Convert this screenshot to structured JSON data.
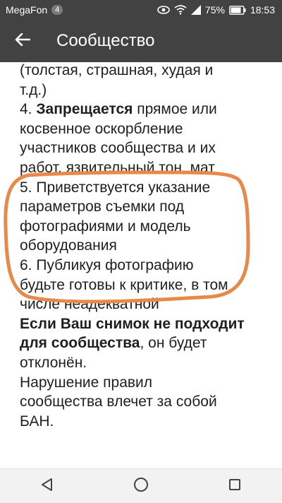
{
  "status_bar": {
    "carrier": "MegaFon",
    "carrier_badge": "4",
    "battery": "75%",
    "time": "18:53"
  },
  "app_bar": {
    "title": "Сообщество"
  },
  "content": {
    "line_1": "(толстая, страшная, худая и",
    "line_2": "т.д.)",
    "rule_4_number": "4. ",
    "rule_4_bold": "Запрещается",
    "rule_4_rest_1": " прямое или",
    "rule_4_line_2": "косвенное оскорбление",
    "rule_4_line_3": "участников сообщества и их",
    "rule_4_line_4": "работ, язвительный тон, мат",
    "rule_5_line_1": "5. Приветствуется указание",
    "rule_5_line_2": "параметров съемки под",
    "rule_5_line_3": "фотографиями и модель",
    "rule_5_line_4": "оборудования",
    "rule_6_line_1": "6. Публикуя фотографию",
    "rule_6_line_2": "будьте готовы к критике, в том",
    "rule_6_line_3": "числе неадекватной",
    "reject_bold_1": "Если Ваш снимок не подходит",
    "reject_bold_2": "для сообщества",
    "reject_rest": ", он будет",
    "reject_line_3": "отклонён.",
    "ban_line_1": "Нарушение правил",
    "ban_line_2": "сообщества влечет за собой",
    "ban_line_3": "БАН."
  },
  "icons": {
    "back": "arrow-back-icon",
    "nav_back": "triangle-back-icon",
    "nav_home": "circle-home-icon",
    "nav_recents": "square-recents-icon"
  },
  "colors": {
    "bar": "#424242",
    "highlight_stroke": "#e8894a",
    "text": "#1f1f1f"
  }
}
